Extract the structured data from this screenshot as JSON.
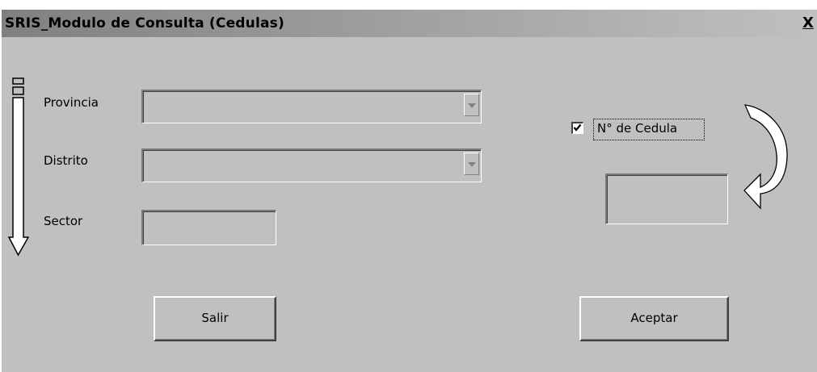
{
  "window": {
    "title": "SRIS_Modulo de Consulta (Cedulas)",
    "close_label": "X"
  },
  "form": {
    "provincia_label": "Provincia",
    "provincia_value": "",
    "distrito_label": "Distrito",
    "distrito_value": "",
    "sector_label": "Sector",
    "sector_value": "",
    "cedula_checkbox_label": "N° de Cedula",
    "cedula_checked": true,
    "cedula_value": ""
  },
  "buttons": {
    "exit_label": "Salir",
    "accept_label": "Aceptar"
  },
  "icons": {
    "down-arrow": "down-arrow-icon",
    "curved-arrow": "curved-arrow-icon",
    "combo-dropdown": "chevron-down-icon"
  },
  "colors": {
    "window_bg": "#c0c0c0",
    "titlebar_start": "#808080",
    "titlebar_end": "#c0c0c0"
  }
}
